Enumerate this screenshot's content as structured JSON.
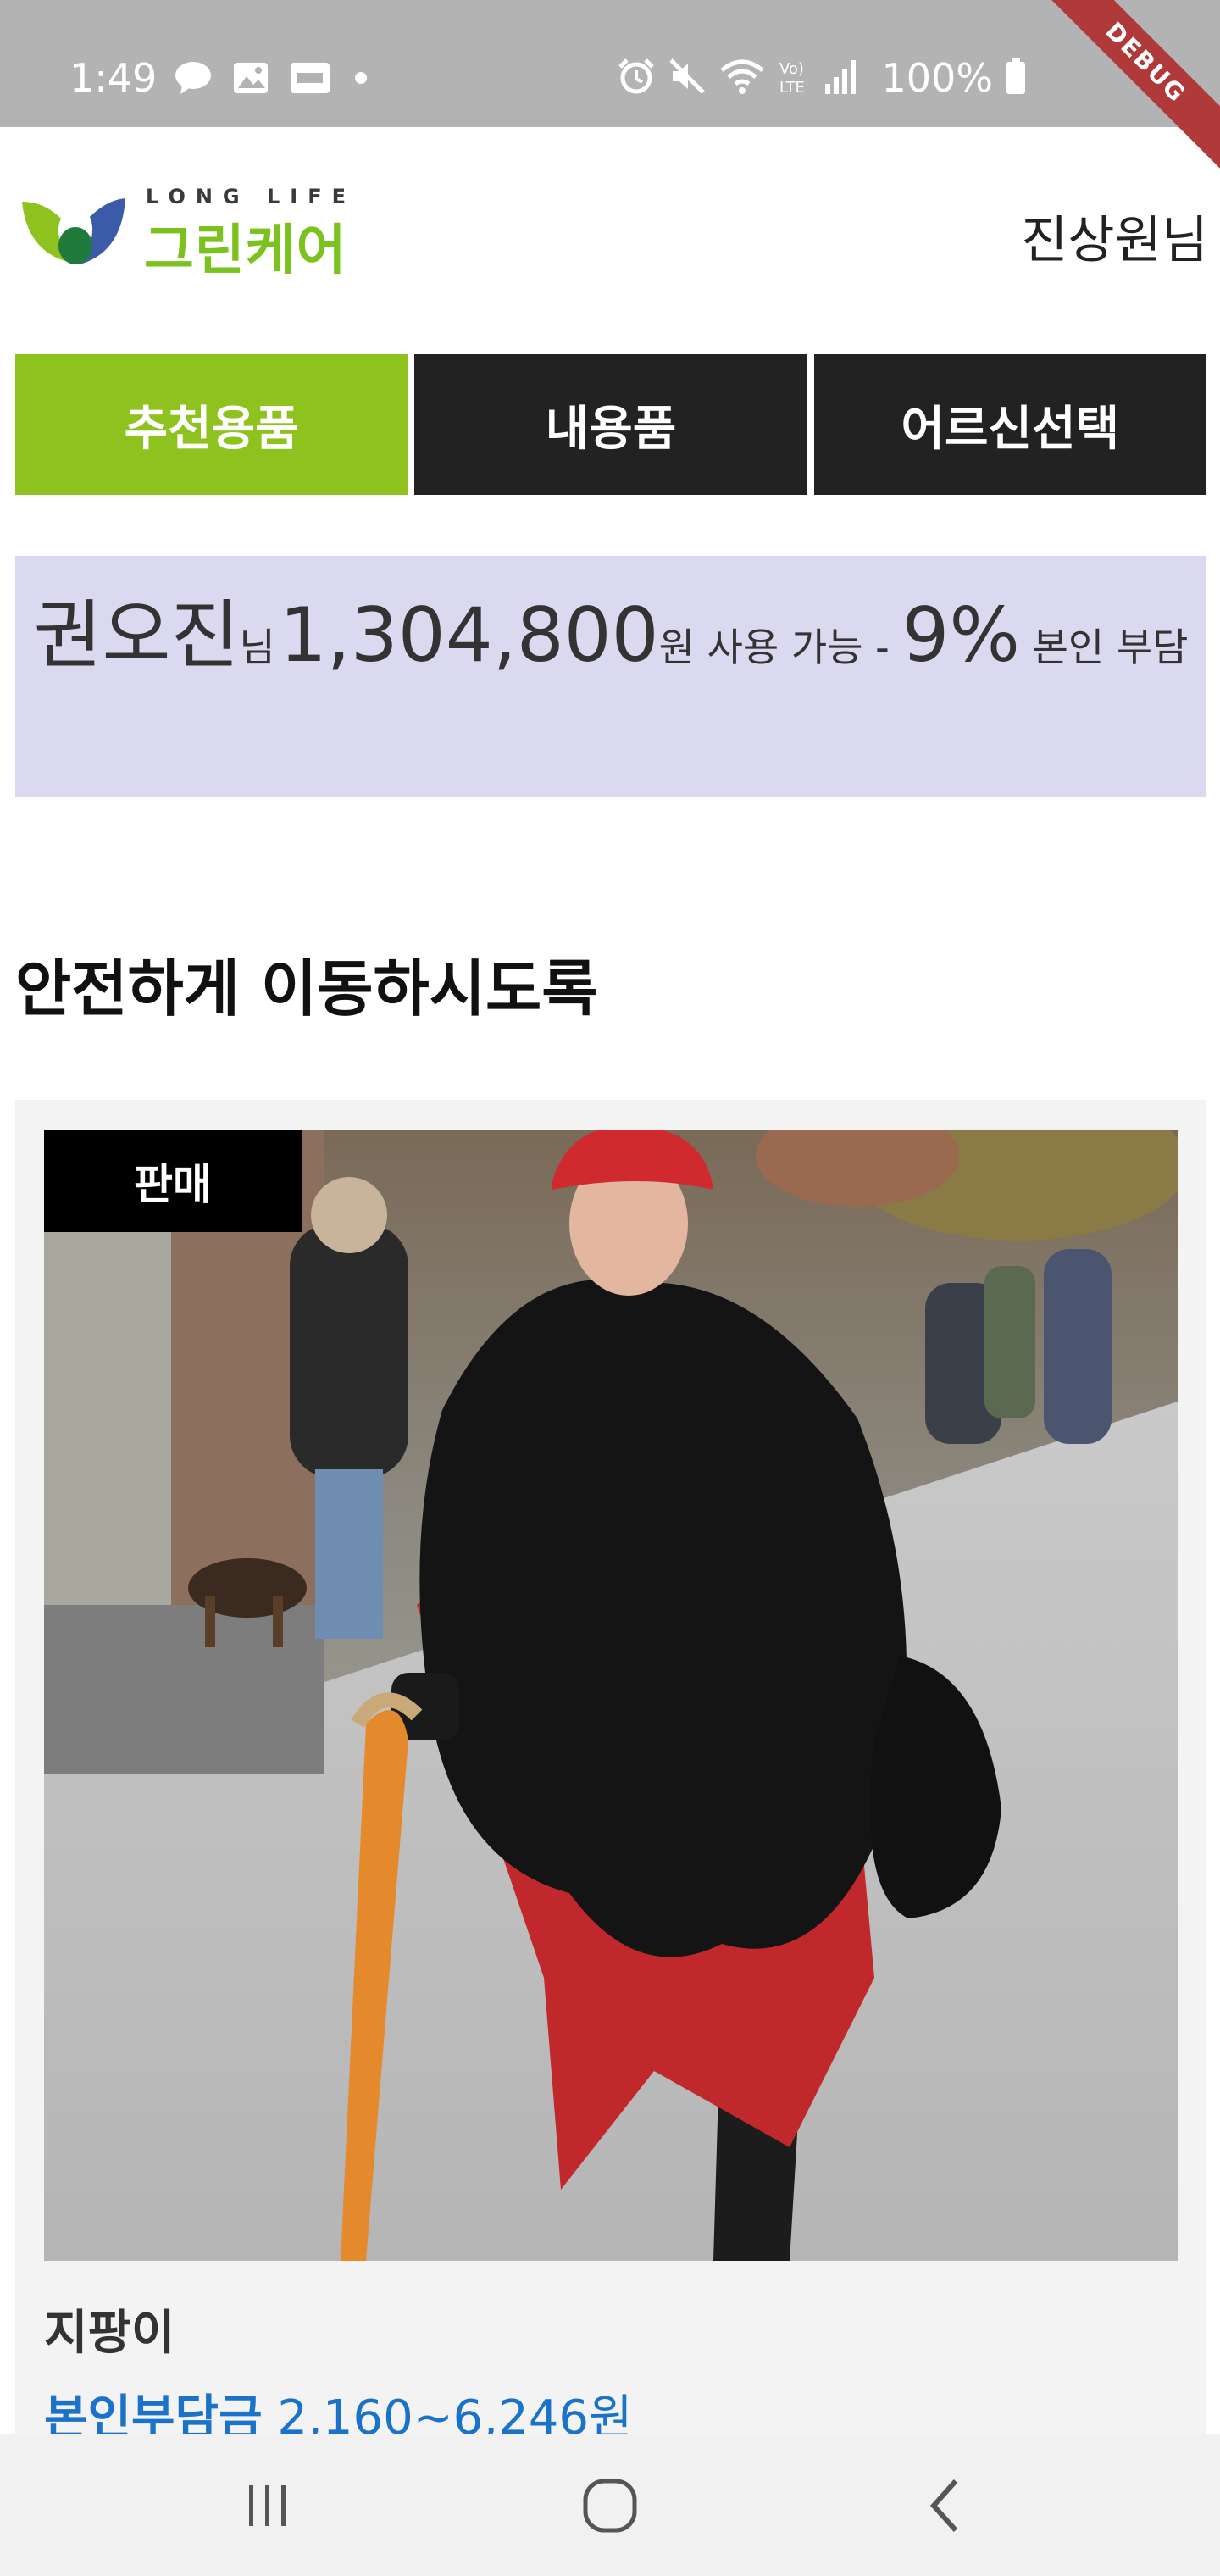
{
  "status_bar": {
    "time": "1:49",
    "battery": "100%",
    "left_icons": [
      "talk-icon",
      "image-icon",
      "rcs-icon"
    ],
    "right_icons": [
      "alarm-icon",
      "mute-icon",
      "wifi-icon",
      "volte-icon",
      "signal-icon",
      "battery-icon"
    ]
  },
  "debug_label": "DEBUG",
  "header": {
    "logo_sub": "LONG LIFE",
    "logo_main": "그린케어",
    "user_name": "진상원님"
  },
  "tabs": [
    {
      "label": "추천용품",
      "active": true
    },
    {
      "label": "내용품",
      "active": false
    },
    {
      "label": "어르신선택",
      "active": false
    }
  ],
  "budget": {
    "name": "권오진",
    "name_suffix": "님",
    "amount": "1,304,800",
    "amount_suffix": "원 사용 가능 - ",
    "percent": "9%",
    "percent_suffix": " 본인 부담"
  },
  "section_title": "안전하게 이동하시도록",
  "product": {
    "badge": "판매",
    "name": "지팡이",
    "price_label": "본인부담금",
    "price_range": "2,160~6,246원"
  },
  "colors": {
    "accent_green": "#8dc21f",
    "tab_dark": "#222222",
    "banner_bg": "#dbd9ef",
    "price_blue": "#1a73c9",
    "status_bar": "#b3b3b3"
  },
  "bottom_nav": [
    "recent-apps-icon",
    "home-icon",
    "back-icon"
  ]
}
